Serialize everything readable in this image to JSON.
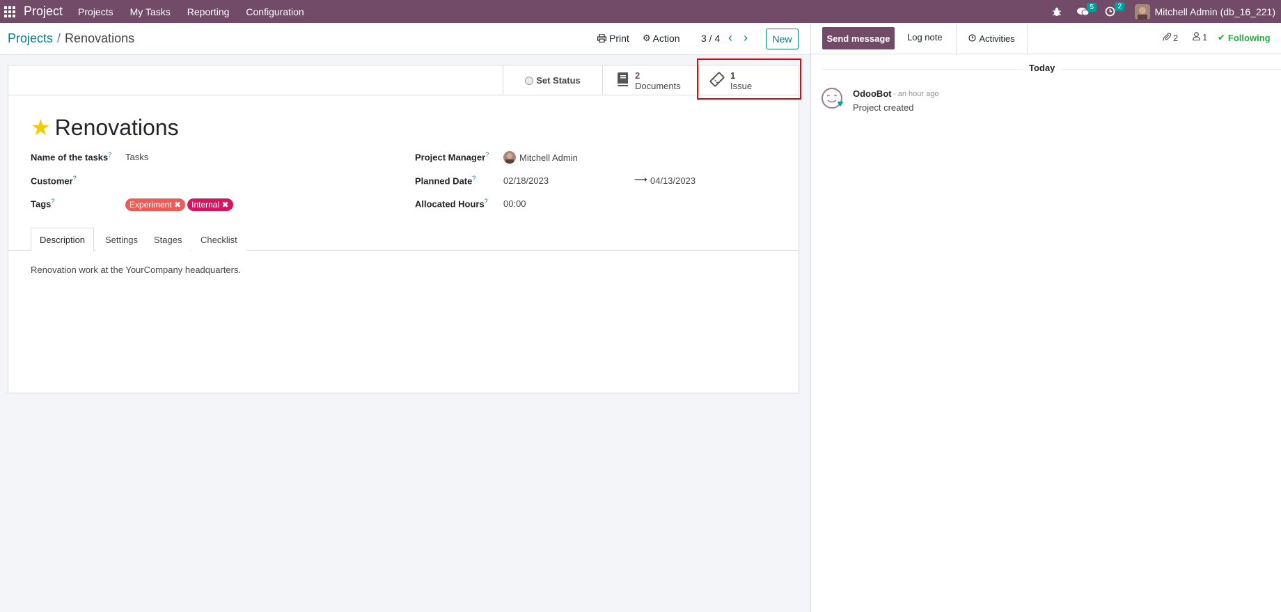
{
  "navbar": {
    "brand": "Project",
    "menu": [
      "Projects",
      "My Tasks",
      "Reporting",
      "Configuration"
    ],
    "messages_count": "5",
    "activities_count": "2",
    "user": "Mitchell Admin (db_16_221)"
  },
  "control_panel": {
    "breadcrumb_parent": "Projects",
    "breadcrumb_sep": "/",
    "breadcrumb_current": "Renovations",
    "print_label": "Print",
    "action_label": "Action",
    "pager": "3 / 4",
    "new_label": "New"
  },
  "button_box": {
    "set_status": "Set Status",
    "documents_count": "2",
    "documents_label": "Documents",
    "issue_count": "1",
    "issue_label": "Issue"
  },
  "form": {
    "title": "Renovations",
    "fields": {
      "tasks_name_label": "Name of the tasks",
      "tasks_name_value": "Tasks",
      "customer_label": "Customer",
      "tags_label": "Tags",
      "tags": [
        {
          "label": "Experiment",
          "color": "#ec5b56"
        },
        {
          "label": "Internal",
          "color": "#d6145f"
        }
      ],
      "manager_label": "Project Manager",
      "manager_value": "Mitchell Admin",
      "planned_date_label": "Planned Date",
      "planned_start": "02/18/2023",
      "planned_end": "04/13/2023",
      "allocated_hours_label": "Allocated Hours",
      "allocated_hours_value": "00:00"
    },
    "tabs": [
      "Description",
      "Settings",
      "Stages",
      "Checklist"
    ],
    "description": "Renovation work at the YourCompany headquarters."
  },
  "chatter": {
    "send_message": "Send message",
    "log_note": "Log note",
    "activities": "Activities",
    "attachments_count": "2",
    "followers_count": "1",
    "following": "Following",
    "date_separator": "Today",
    "messages": [
      {
        "author": "OdooBot",
        "time": "- an hour ago",
        "body": "Project created"
      }
    ]
  },
  "colors": {
    "brand": "#714b67",
    "accent": "#017e84",
    "star": "#f3cc00"
  }
}
